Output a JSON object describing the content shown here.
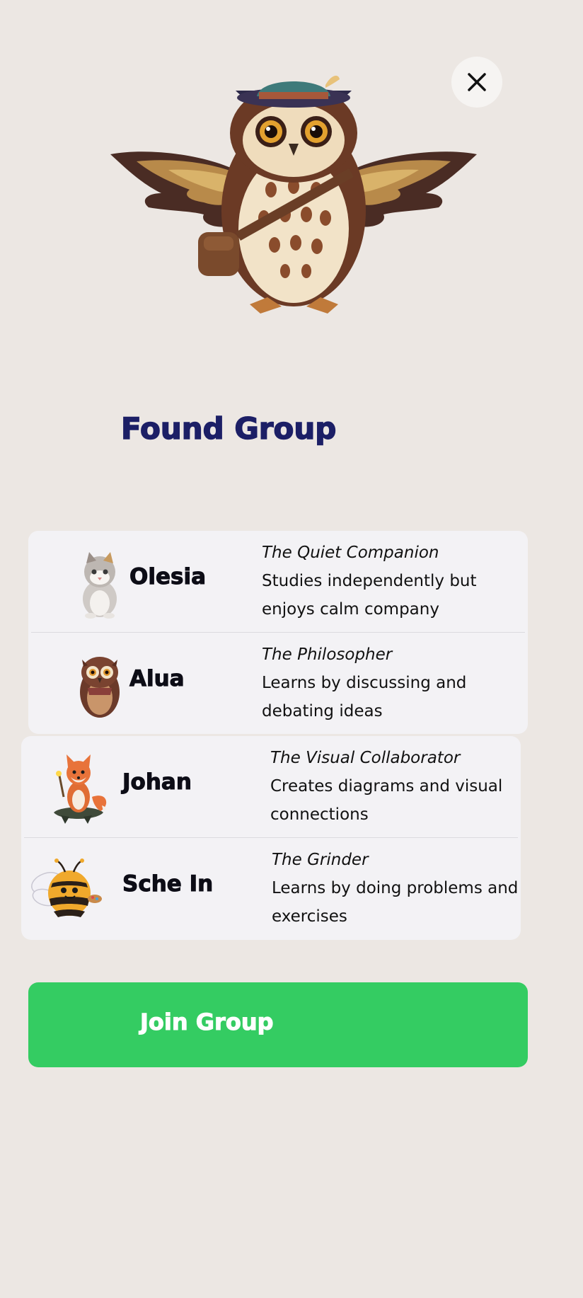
{
  "header": {
    "close_icon": "close-icon",
    "hero_icon": "owl-mascot-icon"
  },
  "title": "Found Group",
  "members": [
    {
      "name": "Olesia",
      "role": "The Quiet Companion",
      "description": "Studies independently but enjoys calm company",
      "avatar_icon": "cat-avatar-icon"
    },
    {
      "name": "Alua",
      "role": "The Philosopher",
      "description": "Learns by discussing and debating ideas",
      "avatar_icon": "owl-avatar-icon"
    },
    {
      "name": "Johan",
      "role": "The Visual Collaborator",
      "description": "Creates diagrams and visual connections",
      "avatar_icon": "fox-avatar-icon"
    },
    {
      "name": "Sche In",
      "role": "The Grinder",
      "description": "Learns by doing problems and exercises",
      "avatar_icon": "bee-avatar-icon"
    }
  ],
  "join_button": {
    "label": "Join Group",
    "color": "#34cc62"
  },
  "colors": {
    "background": "#ece7e3",
    "title": "#1c1f66",
    "card": "#f3f2f5"
  }
}
